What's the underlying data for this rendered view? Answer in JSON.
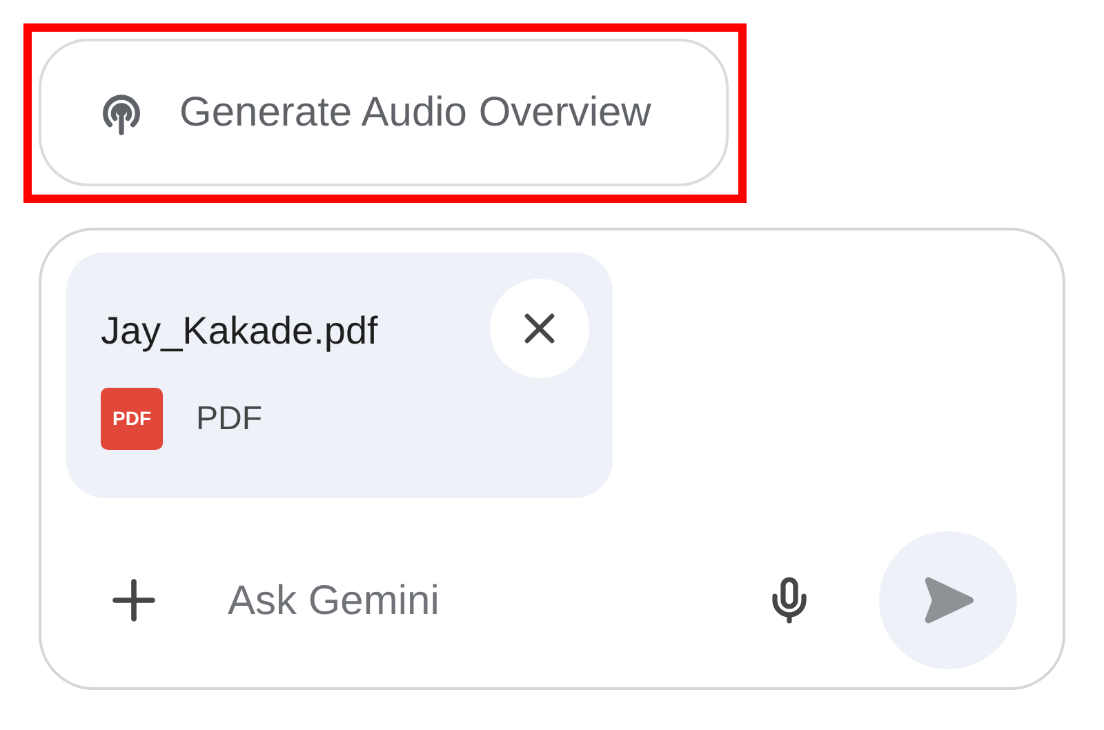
{
  "audio_button": {
    "label": "Generate Audio Overview",
    "highlighted": true
  },
  "attachment": {
    "file_name": "Jay_Kakade.pdf",
    "badge": "PDF",
    "type_label": "PDF"
  },
  "prompt": {
    "placeholder": "Ask Gemini"
  }
}
